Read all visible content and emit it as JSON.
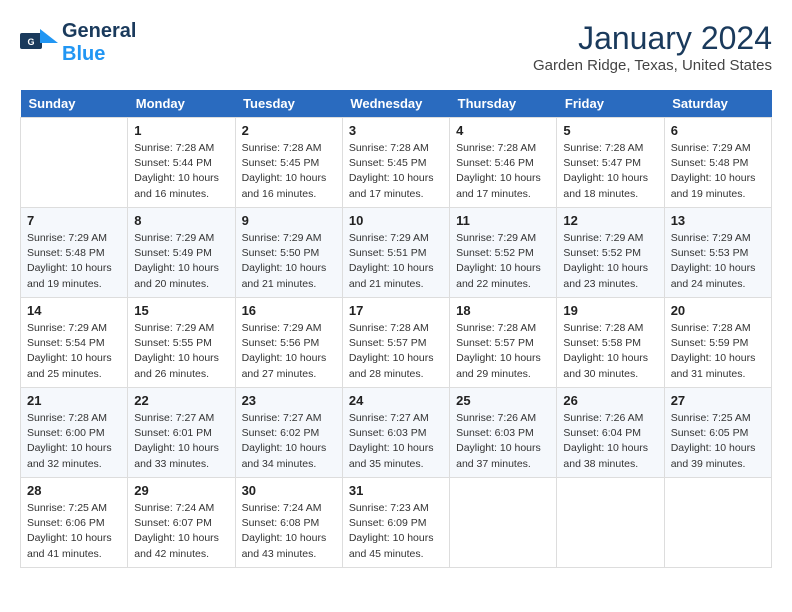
{
  "logo": {
    "line1": "General",
    "line2": "Blue"
  },
  "title": "January 2024",
  "location": "Garden Ridge, Texas, United States",
  "days_of_week": [
    "Sunday",
    "Monday",
    "Tuesday",
    "Wednesday",
    "Thursday",
    "Friday",
    "Saturday"
  ],
  "weeks": [
    [
      {
        "day": "",
        "info": ""
      },
      {
        "day": "1",
        "info": "Sunrise: 7:28 AM\nSunset: 5:44 PM\nDaylight: 10 hours\nand 16 minutes."
      },
      {
        "day": "2",
        "info": "Sunrise: 7:28 AM\nSunset: 5:45 PM\nDaylight: 10 hours\nand 16 minutes."
      },
      {
        "day": "3",
        "info": "Sunrise: 7:28 AM\nSunset: 5:45 PM\nDaylight: 10 hours\nand 17 minutes."
      },
      {
        "day": "4",
        "info": "Sunrise: 7:28 AM\nSunset: 5:46 PM\nDaylight: 10 hours\nand 17 minutes."
      },
      {
        "day": "5",
        "info": "Sunrise: 7:28 AM\nSunset: 5:47 PM\nDaylight: 10 hours\nand 18 minutes."
      },
      {
        "day": "6",
        "info": "Sunrise: 7:29 AM\nSunset: 5:48 PM\nDaylight: 10 hours\nand 19 minutes."
      }
    ],
    [
      {
        "day": "7",
        "info": "Sunrise: 7:29 AM\nSunset: 5:48 PM\nDaylight: 10 hours\nand 19 minutes."
      },
      {
        "day": "8",
        "info": "Sunrise: 7:29 AM\nSunset: 5:49 PM\nDaylight: 10 hours\nand 20 minutes."
      },
      {
        "day": "9",
        "info": "Sunrise: 7:29 AM\nSunset: 5:50 PM\nDaylight: 10 hours\nand 21 minutes."
      },
      {
        "day": "10",
        "info": "Sunrise: 7:29 AM\nSunset: 5:51 PM\nDaylight: 10 hours\nand 21 minutes."
      },
      {
        "day": "11",
        "info": "Sunrise: 7:29 AM\nSunset: 5:52 PM\nDaylight: 10 hours\nand 22 minutes."
      },
      {
        "day": "12",
        "info": "Sunrise: 7:29 AM\nSunset: 5:52 PM\nDaylight: 10 hours\nand 23 minutes."
      },
      {
        "day": "13",
        "info": "Sunrise: 7:29 AM\nSunset: 5:53 PM\nDaylight: 10 hours\nand 24 minutes."
      }
    ],
    [
      {
        "day": "14",
        "info": "Sunrise: 7:29 AM\nSunset: 5:54 PM\nDaylight: 10 hours\nand 25 minutes."
      },
      {
        "day": "15",
        "info": "Sunrise: 7:29 AM\nSunset: 5:55 PM\nDaylight: 10 hours\nand 26 minutes."
      },
      {
        "day": "16",
        "info": "Sunrise: 7:29 AM\nSunset: 5:56 PM\nDaylight: 10 hours\nand 27 minutes."
      },
      {
        "day": "17",
        "info": "Sunrise: 7:28 AM\nSunset: 5:57 PM\nDaylight: 10 hours\nand 28 minutes."
      },
      {
        "day": "18",
        "info": "Sunrise: 7:28 AM\nSunset: 5:57 PM\nDaylight: 10 hours\nand 29 minutes."
      },
      {
        "day": "19",
        "info": "Sunrise: 7:28 AM\nSunset: 5:58 PM\nDaylight: 10 hours\nand 30 minutes."
      },
      {
        "day": "20",
        "info": "Sunrise: 7:28 AM\nSunset: 5:59 PM\nDaylight: 10 hours\nand 31 minutes."
      }
    ],
    [
      {
        "day": "21",
        "info": "Sunrise: 7:28 AM\nSunset: 6:00 PM\nDaylight: 10 hours\nand 32 minutes."
      },
      {
        "day": "22",
        "info": "Sunrise: 7:27 AM\nSunset: 6:01 PM\nDaylight: 10 hours\nand 33 minutes."
      },
      {
        "day": "23",
        "info": "Sunrise: 7:27 AM\nSunset: 6:02 PM\nDaylight: 10 hours\nand 34 minutes."
      },
      {
        "day": "24",
        "info": "Sunrise: 7:27 AM\nSunset: 6:03 PM\nDaylight: 10 hours\nand 35 minutes."
      },
      {
        "day": "25",
        "info": "Sunrise: 7:26 AM\nSunset: 6:03 PM\nDaylight: 10 hours\nand 37 minutes."
      },
      {
        "day": "26",
        "info": "Sunrise: 7:26 AM\nSunset: 6:04 PM\nDaylight: 10 hours\nand 38 minutes."
      },
      {
        "day": "27",
        "info": "Sunrise: 7:25 AM\nSunset: 6:05 PM\nDaylight: 10 hours\nand 39 minutes."
      }
    ],
    [
      {
        "day": "28",
        "info": "Sunrise: 7:25 AM\nSunset: 6:06 PM\nDaylight: 10 hours\nand 41 minutes."
      },
      {
        "day": "29",
        "info": "Sunrise: 7:24 AM\nSunset: 6:07 PM\nDaylight: 10 hours\nand 42 minutes."
      },
      {
        "day": "30",
        "info": "Sunrise: 7:24 AM\nSunset: 6:08 PM\nDaylight: 10 hours\nand 43 minutes."
      },
      {
        "day": "31",
        "info": "Sunrise: 7:23 AM\nSunset: 6:09 PM\nDaylight: 10 hours\nand 45 minutes."
      },
      {
        "day": "",
        "info": ""
      },
      {
        "day": "",
        "info": ""
      },
      {
        "day": "",
        "info": ""
      }
    ]
  ]
}
